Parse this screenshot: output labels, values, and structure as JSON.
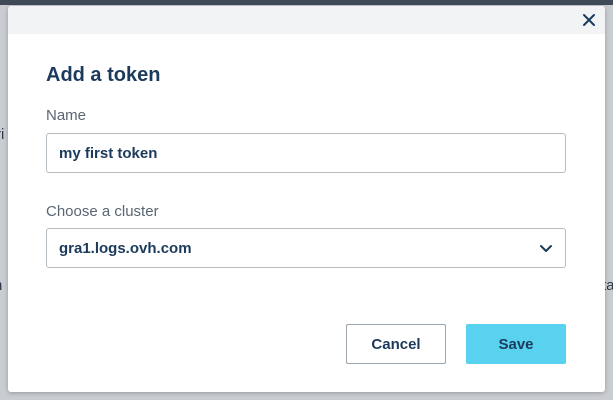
{
  "background": {
    "fragments": [
      "ri",
      "n",
      "ta"
    ]
  },
  "modal": {
    "title": "Add a token",
    "close_icon": "close-icon",
    "name_field": {
      "label": "Name",
      "value": "my first token"
    },
    "cluster_field": {
      "label": "Choose a cluster",
      "selected": "gra1.logs.ovh.com",
      "icon": "chevron-down-icon"
    },
    "buttons": {
      "cancel": "Cancel",
      "save": "Save"
    }
  },
  "colors": {
    "title": "#1b3a5c",
    "label": "#5a6673",
    "primary_button": "#59d2ef",
    "header_band": "#f1f3f4",
    "overlay": "#c9ccd0"
  }
}
